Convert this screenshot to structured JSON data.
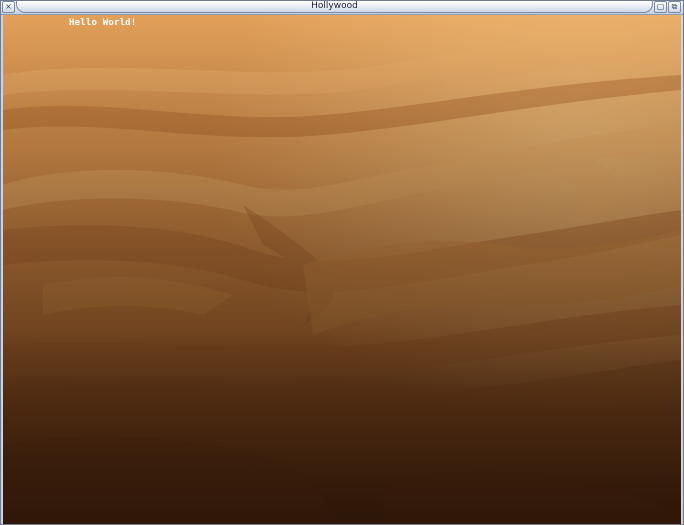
{
  "window": {
    "title": "Hollywood",
    "close_glyph": "×",
    "depth_glyph": "▢",
    "zoom_glyph": "⧉"
  },
  "content": {
    "text": "Hello World!"
  },
  "background": {
    "subject": "desert sand dunes",
    "colors": {
      "light_sand": "#f0b265",
      "mid_sand": "#d48a45",
      "shadow_sand": "#a8622c",
      "dark_bottom": "#2e1608"
    }
  }
}
